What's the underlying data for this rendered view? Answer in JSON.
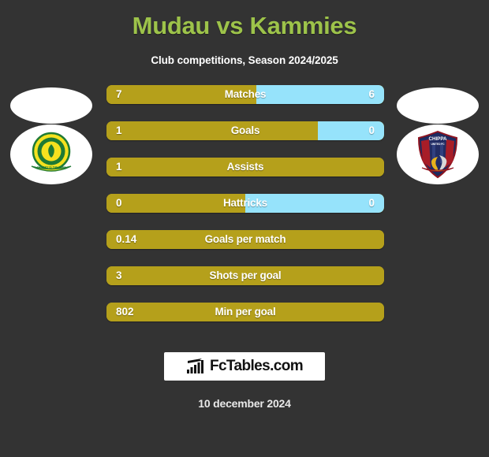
{
  "header": {
    "title": "Mudau vs Kammies",
    "subtitle": "Club competitions, Season 2024/2025",
    "title_color": "#9dc34a",
    "subtitle_color": "#ffffff"
  },
  "theme": {
    "background": "#333333",
    "home_bar_color": "#b5a01b",
    "away_bar_color": "#96e3fb",
    "value_text_color": "#ffffff"
  },
  "teams": {
    "home": {
      "crest_name": "mamelodi-sundowns-crest"
    },
    "away": {
      "crest_name": "chippa-united-crest",
      "crest_text_top": "CHIPPA",
      "crest_text_sub": "UNITED FC"
    }
  },
  "chart_data": {
    "type": "bar",
    "title": "Mudau vs Kammies",
    "subtitle": "Club competitions, Season 2024/2025",
    "orientation": "horizontal-diverging",
    "series": [
      {
        "name": "Mudau",
        "color": "#b5a01b"
      },
      {
        "name": "Kammies",
        "color": "#96e3fb"
      }
    ],
    "categories": [
      "Matches",
      "Goals",
      "Assists",
      "Hattricks",
      "Goals per match",
      "Shots per goal",
      "Min per goal"
    ],
    "rows": [
      {
        "label": "Matches",
        "left_value": "7",
        "right_value": "6",
        "left_pct": 54,
        "has_right": true
      },
      {
        "label": "Goals",
        "left_value": "1",
        "right_value": "0",
        "left_pct": 76,
        "has_right": true
      },
      {
        "label": "Assists",
        "left_value": "1",
        "right_value": "",
        "left_pct": 100,
        "has_right": false
      },
      {
        "label": "Hattricks",
        "left_value": "0",
        "right_value": "0",
        "left_pct": 50,
        "has_right": true
      },
      {
        "label": "Goals per match",
        "left_value": "0.14",
        "right_value": "",
        "left_pct": 100,
        "has_right": false
      },
      {
        "label": "Shots per goal",
        "left_value": "3",
        "right_value": "",
        "left_pct": 100,
        "has_right": false
      },
      {
        "label": "Min per goal",
        "left_value": "802",
        "right_value": "",
        "left_pct": 100,
        "has_right": false
      }
    ]
  },
  "footer": {
    "brand": "FcTables.com",
    "brand_icon": "bar-chart-arrow-icon",
    "date": "10 december 2024"
  }
}
